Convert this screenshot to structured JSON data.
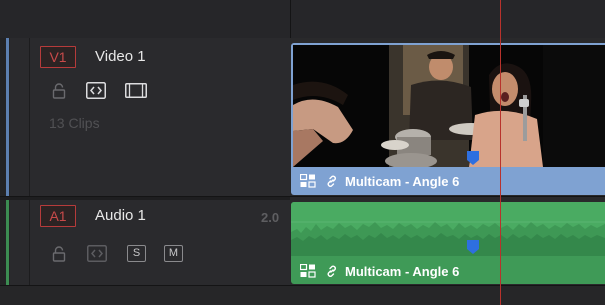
{
  "video_track": {
    "badge": "V1",
    "name": "Video 1",
    "clip_count": "13 Clips",
    "controls": [
      "lock-icon",
      "auto-select-icon",
      "film-strip-icon"
    ],
    "clip": {
      "label": "Multicam - Angle 6",
      "color": "#7fa2d2"
    }
  },
  "audio_track": {
    "badge": "A1",
    "name": "Audio 1",
    "level": "2.0",
    "controls": {
      "solo": "S",
      "mute": "M"
    },
    "control_icons": [
      "lock-icon",
      "auto-select-icon"
    ],
    "clip": {
      "label": "Multicam - Angle 6",
      "color": "#3f9a57"
    }
  },
  "colors": {
    "playhead": "#b8322c",
    "marker": "#2e6fe0",
    "track_badge": "#b63b3b"
  }
}
